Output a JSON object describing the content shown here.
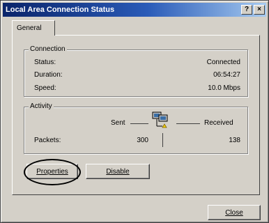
{
  "window": {
    "title": "Local Area Connection Status",
    "buttons": {
      "help": "?",
      "close": "×"
    }
  },
  "tabs": [
    {
      "label": "General"
    }
  ],
  "connection": {
    "legend": "Connection",
    "status_label": "Status:",
    "status_value": "Connected",
    "duration_label": "Duration:",
    "duration_value": "06:54:27",
    "speed_label": "Speed:",
    "speed_value": "10.0 Mbps"
  },
  "activity": {
    "legend": "Activity",
    "sent_label": "Sent",
    "received_label": "Received",
    "packets_label": "Packets:",
    "packets_sent": "300",
    "packets_received": "138",
    "icon": "network-computers-icon"
  },
  "buttons": {
    "properties": "Properties",
    "disable": "Disable",
    "close": "Close"
  },
  "colors": {
    "title_start": "#0a246a",
    "title_end": "#a6caf0",
    "face": "#d4d0c8"
  }
}
